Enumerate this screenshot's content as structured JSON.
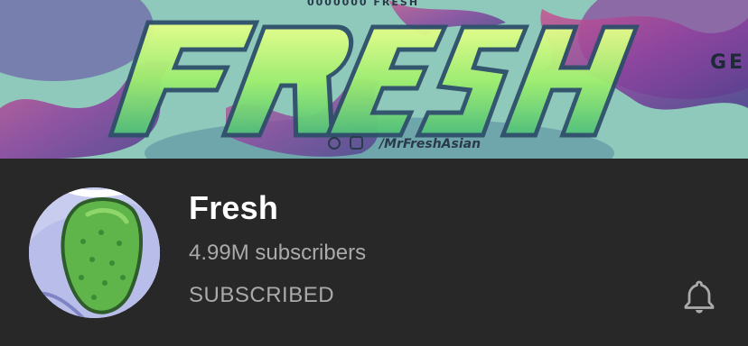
{
  "banner": {
    "title": "FRESH",
    "social_handle": "/MrFreshAsian",
    "top_text": "0000000 FRESH"
  },
  "channel": {
    "name": "Fresh",
    "subscribers": "4.99M subscribers",
    "subscribe_state": "SUBSCRIBED"
  },
  "icons": {
    "notification": "bell-icon",
    "avatar": "pickle-avatar"
  },
  "colors": {
    "background": "#282828",
    "primary_text": "#ffffff",
    "secondary_text": "#aaaaaa"
  }
}
